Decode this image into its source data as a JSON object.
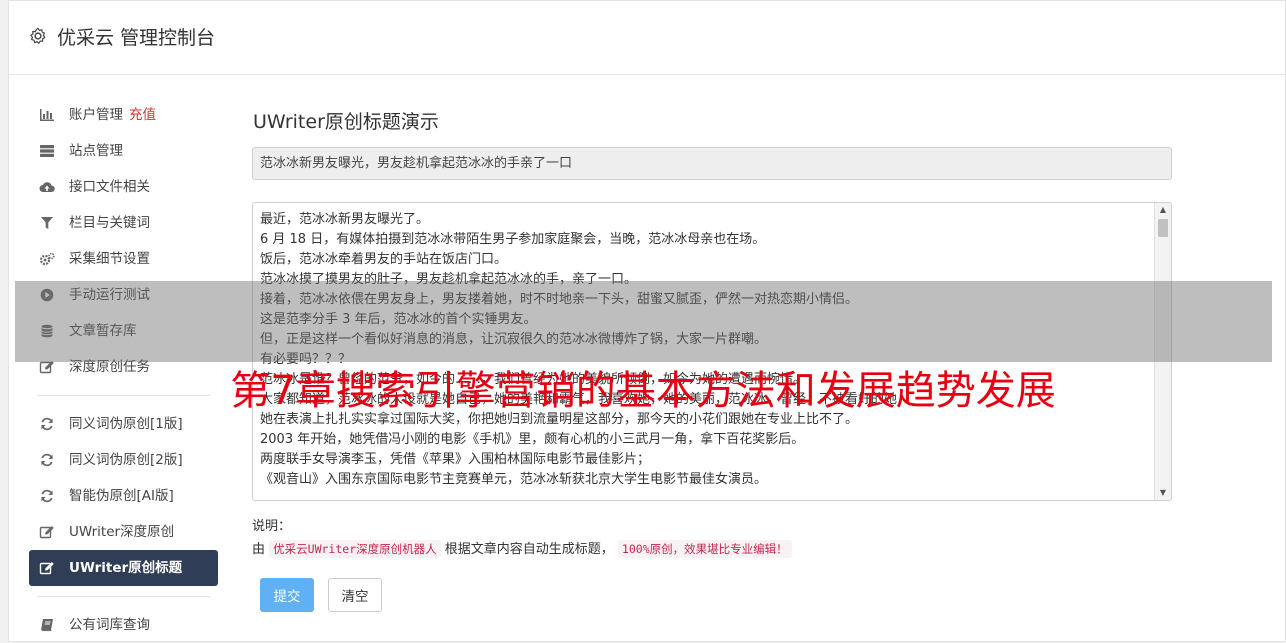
{
  "header": {
    "title": "优采云 管理控制台",
    "icon": "gear-icon"
  },
  "sidebar": {
    "groups": [
      [
        {
          "label": "账户管理",
          "badge": "充值",
          "icon": "bar-chart-icon"
        },
        {
          "label": "站点管理",
          "icon": "server-icon"
        },
        {
          "label": "接口文件相关",
          "icon": "cloud-upload-icon"
        },
        {
          "label": "栏目与关键词",
          "icon": "filter-icon"
        },
        {
          "label": "采集细节设置",
          "icon": "cogs-icon"
        },
        {
          "label": "手动运行测试",
          "icon": "play-circle-icon"
        },
        {
          "label": "文章暂存库",
          "icon": "database-icon"
        },
        {
          "label": "深度原创任务",
          "icon": "edit-icon"
        }
      ],
      [
        {
          "label": "同义词伪原创[1版]",
          "icon": "refresh-icon"
        },
        {
          "label": "同义词伪原创[2版]",
          "icon": "refresh-icon"
        },
        {
          "label": "智能伪原创[AI版]",
          "icon": "refresh-icon"
        },
        {
          "label": "UWriter深度原创",
          "icon": "edit-icon"
        },
        {
          "label": "UWriter原创标题",
          "icon": "edit-icon",
          "active": true
        }
      ],
      [
        {
          "label": "公有词库查询",
          "icon": "book-icon"
        }
      ]
    ]
  },
  "main": {
    "heading": "UWriter原创标题演示",
    "title_value": "范冰冰新男友曝光，男友趁机拿起范冰冰的手亲了一口",
    "content_lines": [
      "最近，范冰冰新男友曝光了。",
      "6 月 18 日，有媒体拍摄到范冰冰带陌生男子参加家庭聚会，当晚，范冰冰母亲也在场。",
      "饭后，范冰冰牵着男友的手站在饭店门口。",
      "范冰冰摸了摸男友的肚子，男友趁机拿起范冰冰的手，亲了一口。",
      "接着，范冰冰依偎在男友身上，男友搂着她，时不时地亲一下头，甜蜜又腻歪，俨然一对热恋期小情侣。",
      "这是范李分手 3 年后，范冰冰的首个实锤男友。",
      "但，正是这样一个看似好消息的消息，让沉寂很久的范冰冰微博炸了锅，大家一片群嘲。",
      "有必要吗？？？",
      "范冰冰是谁？曾经的范爷，如今的……，我们曾经为她的美貌所倾倒，如今为她的遭遇而惋惜。",
      "大家都知道，范冰冰的人设就是她自己，她的美艳和霸气，我喜欢她，她的美丽，范冰冰，曾经，不被看好的她，",
      "她在表演上扎扎实实拿过国际大奖，你把她归到流量明星这部分，那今天的小花们跟她在专业上比不了。",
      "2003 年开始，她凭借冯小刚的电影《手机》里，颇有心机的小三武月一角，拿下百花奖影后。",
      "两度联手女导演李玉，凭借《苹果》入围柏林国际电影节最佳影片；",
      "《观音山》入围东京国际电影节主竞赛单元，范冰冰斩获北京大学生电影节最佳女演员。"
    ],
    "note_label": "说明：",
    "note_prefix": "由",
    "note_code1": "优采云UWriter深度原创机器人",
    "note_middle": "根据文章内容自动生成标题，",
    "note_code2": "100%原创，效果堪比专业编辑！",
    "submit_label": "提交",
    "clear_label": "清空"
  },
  "watermark": "第7章搜索引擎营销的基本方法和发展趋势发展",
  "colors": {
    "accent": "#5fb1f3",
    "active_nav": "#2f3d57",
    "badge": "#d9302c",
    "watermark": "#e60012",
    "code": "#c7254e"
  }
}
